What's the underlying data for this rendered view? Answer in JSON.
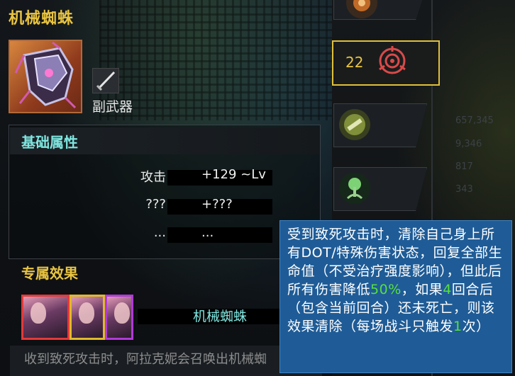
{
  "item": {
    "title": "机械蜘蛛",
    "weapon_type": "副武器",
    "weapon_type_icon": "dagger-icon"
  },
  "basic_attributes": {
    "title": "基础属性",
    "stats": [
      {
        "name": "攻击",
        "value": "+129 ~Lv"
      },
      {
        "name": "???",
        "value": "+???"
      },
      {
        "name": "...",
        "value": "..."
      }
    ]
  },
  "exclusive_effect": {
    "title": "专属效果",
    "portraits": [
      {
        "border_color": "#e23a3a"
      },
      {
        "border_color": "#e0b92c"
      },
      {
        "border_color": "#b13ad8"
      }
    ],
    "effect_name": "机械蜘蛛",
    "description": "收到致死攻击时，阿拉克妮会召唤出机械蜘"
  },
  "right_slots": [
    {
      "icon": "orb-icon"
    },
    {
      "icon": "target-icon",
      "count": "22",
      "selected": true
    },
    {
      "icon": "bone-icon"
    },
    {
      "icon": "tree-icon"
    }
  ],
  "background_numbers": [
    "657,345",
    "9,346",
    "817",
    "343"
  ],
  "tooltip": {
    "part1": "受到致死攻击时，清除自己身上所有DOT/特殊伤害状态，回复全部生命值（不受治疗强度影响），但此后所有伤害降低",
    "pct": "50%",
    "part2": "，如果",
    "rounds": "4",
    "part3": "回合后（包含当前回合）还未死亡，则该效果清除（每场战斗只触发",
    "times": "1",
    "part4": "次）"
  },
  "colors": {
    "title_gold": "#e9c441",
    "section_cyan": "#7fe6e0",
    "tooltip_bg": "#1f5c97",
    "highlight_green": "#57e03b"
  }
}
